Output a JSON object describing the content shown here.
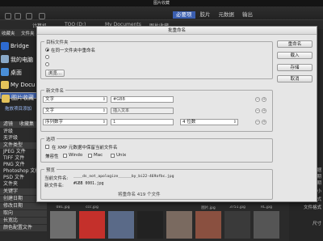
{
  "window_title": "图片收藏",
  "workspace_tabs": [
    "必要项",
    "胶片",
    "元数据",
    "输出"
  ],
  "path": [
    "计算机",
    "TOO (D:)",
    "My Documents",
    "图片收藏"
  ],
  "left_panel": {
    "tabs": [
      "收藏夹",
      "文件夹"
    ],
    "favorites": [
      "Bridge",
      "我的电脑",
      "桌面",
      "My Docu",
      "图片收藏"
    ],
    "sub_link": "拖放项目添加",
    "filter_tabs": [
      "滤镜",
      "收藏集"
    ],
    "filters": [
      "评级",
      "无评级",
      "文件类型",
      "JPEG 文件",
      "TIFF 文件",
      "PNG 文件",
      "Photoshop 文档",
      "PSD 文件",
      "文件夹",
      "关键字",
      "创建日期",
      "修改日期",
      "取向",
      "长宽比",
      "颜色配置文件"
    ]
  },
  "right_panel": [
    "数据",
    "日期",
    "修改日期",
    "大小",
    "文件格式",
    "文件格式",
    "尺寸"
  ],
  "thumbs": [
    "081.jpg",
    "ccc.jpg",
    "",
    "",
    "",
    "",
    "图片.jpg",
    "",
    "3751.jpg",
    "RL.jpg"
  ],
  "dialog": {
    "title": "批重命名",
    "buttons": [
      "重命名",
      "载入",
      "存储",
      "取消"
    ],
    "dest": {
      "label": "目标文件夹",
      "options": [
        "在同一文件夹中重命名",
        "",
        ""
      ],
      "browse": "浏览..."
    },
    "newname": {
      "label": "新文件名",
      "rows": [
        {
          "type": "文字",
          "value": "#GBB",
          "extra": ""
        },
        {
          "type": "文字",
          "value": "",
          "extra": "插入文本"
        },
        {
          "type": "序列数字",
          "value": "1",
          "extra": "4 位数"
        }
      ]
    },
    "options": {
      "label": "选项",
      "keep_xmp": "在 XMP 元数据中保留当前文件名",
      "compat_label": "兼容性",
      "compat": [
        "Windo",
        "Mac",
        "Unix"
      ]
    },
    "preview": {
      "label": "预览",
      "current_label": "当前文件名:",
      "current_value": "____ds_not_apologize______by_bi22-469afbc.jpg",
      "new_label": "新文件名:",
      "new_value": "#GBB 0001.jpg",
      "count": "将重命名 419 个文件"
    }
  },
  "colors": {
    "accent": "#3b5fb0",
    "dialog_bg": "#e6e6e6"
  }
}
